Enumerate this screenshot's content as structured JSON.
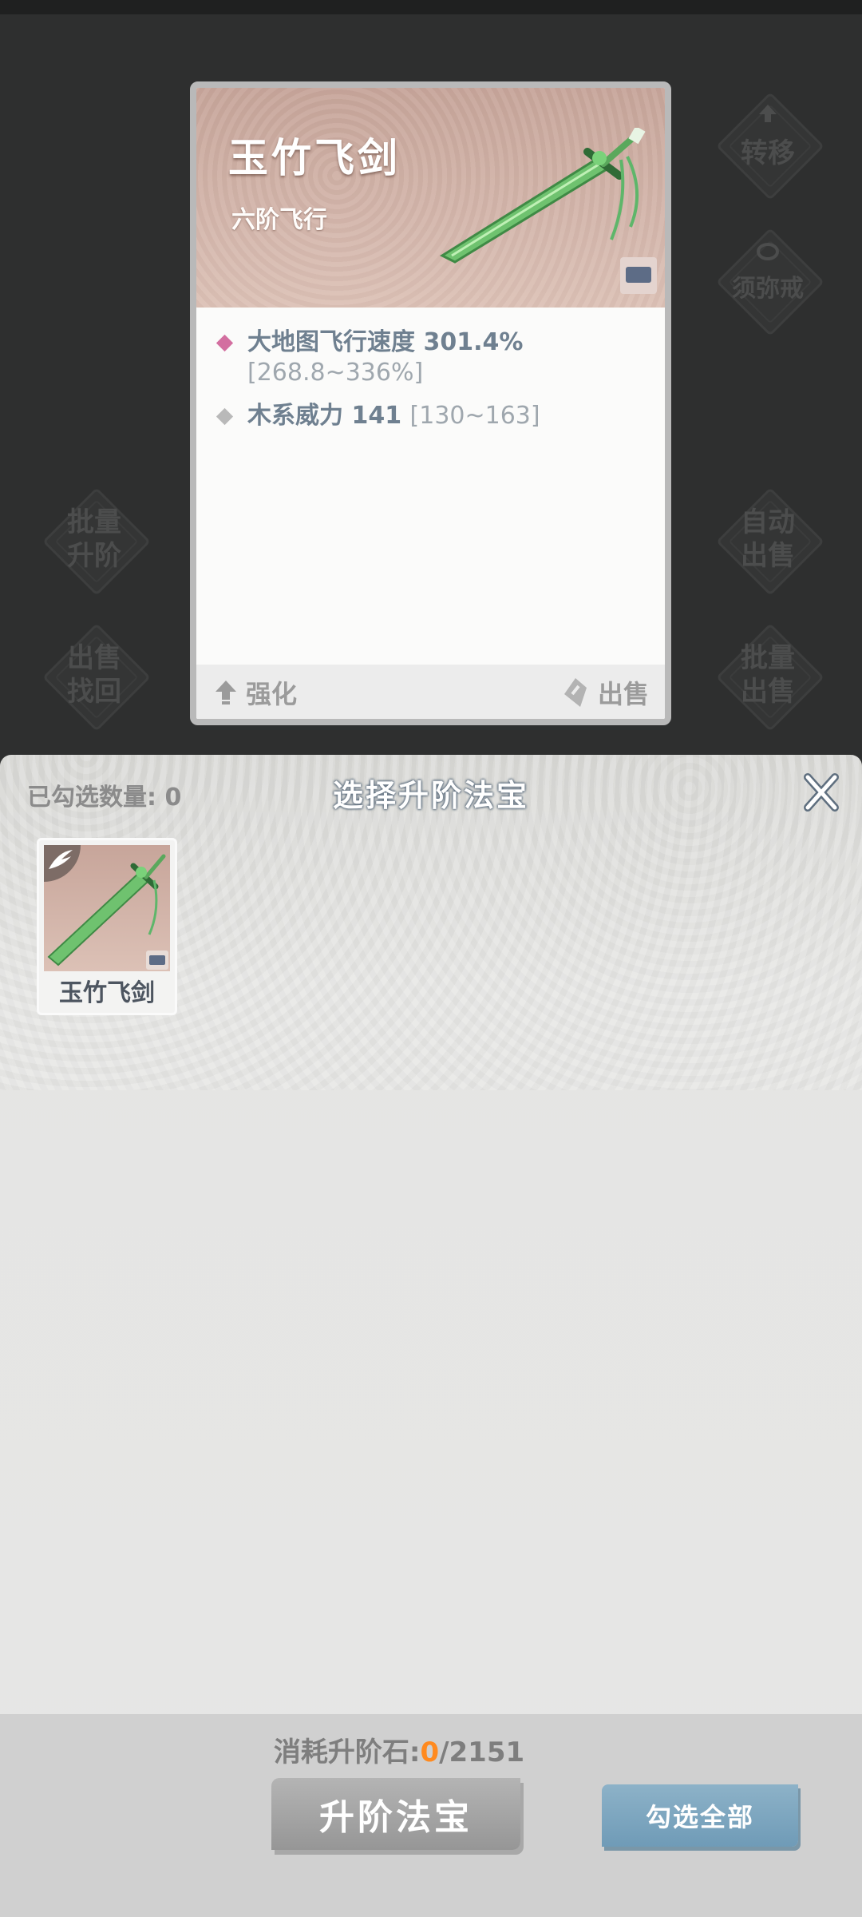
{
  "side_buttons": {
    "transfer": "转移",
    "sumeru_ring": "须弥戒",
    "batch_upgrade": "批量\n升阶",
    "auto_sell": "自动\n出售",
    "buyback": "出售\n找回",
    "batch_sell": "批量\n出售"
  },
  "card": {
    "title": "玉竹飞剑",
    "subtitle": "六阶飞行",
    "stats": [
      {
        "text": "大地图飞行速度 301.4%",
        "range": "[268.8~336%]",
        "dot_color": "#d36fa0"
      },
      {
        "text": "木系威力 141",
        "range": "[130~163]",
        "dot_color": "#b9b9b9"
      }
    ],
    "enhance_label": "强化",
    "sell_label": "出售"
  },
  "panel": {
    "selected_count_label": "已勾选数量: 0",
    "title": "选择升阶法宝",
    "close_label": "X",
    "items": [
      {
        "name": "玉竹飞剑"
      }
    ],
    "cost_label": "消耗升阶石:",
    "cost_current": "0",
    "cost_total": "/2151",
    "upgrade_button": "升阶法宝",
    "select_all_button": "勾选全部"
  }
}
